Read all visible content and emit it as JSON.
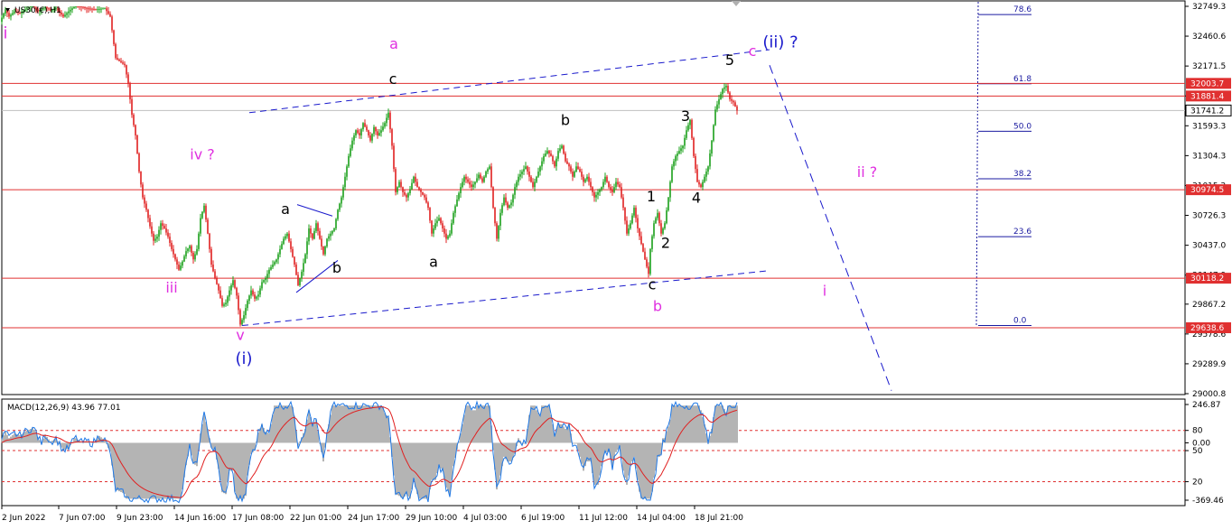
{
  "window": {
    "symbol_label": "US30(€),H1"
  },
  "chart_data": {
    "type": "candlestick",
    "ylim": [
      29000.8,
      32749.3
    ],
    "price_ticks": [
      "32749.3",
      "32460.6",
      "32171.5",
      "31882.4",
      "31593.3",
      "31304.3",
      "31015.2",
      "30726.3",
      "30437.0",
      "30147.9",
      "29867.2",
      "29578.6",
      "29289.9",
      "29000.8"
    ],
    "price_ticks_values": [
      32749.3,
      32460.6,
      32171.5,
      31882.4,
      31593.3,
      31304.3,
      31015.2,
      30726.3,
      30437.0,
      30147.9,
      29867.2,
      29578.6,
      29289.9,
      29000.8
    ],
    "x_tick_labels": [
      "2 Jun 2022",
      "7 Jun 07:00",
      "9 Jun 23:00",
      "14 Jun 16:00",
      "17 Jun 08:00",
      "22 Jun 01:00",
      "24 Jun 17:00",
      "29 Jun 10:00",
      "4 Jul 03:00",
      "6 Jul 19:00",
      "11 Jul 12:00",
      "14 Jul 04:00",
      "18 Jul 21:00"
    ],
    "levels": [
      {
        "label": "32003.7",
        "value": 32003.7,
        "color": "#e03030"
      },
      {
        "label": "31881.4",
        "value": 31881.4,
        "color": "#e03030"
      },
      {
        "label": "31741.2",
        "value": 31741.2,
        "color": "#ffffff"
      },
      {
        "label": "30974.5",
        "value": 30974.5,
        "color": "#e03030"
      },
      {
        "label": "30118.2",
        "value": 30118.2,
        "color": "#e03030"
      },
      {
        "label": "29638.6",
        "value": 29638.6,
        "color": "#e03030"
      }
    ],
    "fib_levels": [
      {
        "label": "78.6",
        "value": 32670
      },
      {
        "label": "61.8",
        "value": 32000
      },
      {
        "label": "50.0",
        "value": 31540
      },
      {
        "label": "38.2",
        "value": 31080
      },
      {
        "label": "23.6",
        "value": 30520
      },
      {
        "label": "0.0",
        "value": 29660
      }
    ],
    "close_path": [
      [
        0,
        32600
      ],
      [
        6,
        32720
      ],
      [
        10,
        32650
      ],
      [
        16,
        32700
      ],
      [
        22,
        32680
      ],
      [
        28,
        32720
      ],
      [
        36,
        32760
      ],
      [
        42,
        32700
      ],
      [
        50,
        32740
      ],
      [
        56,
        32710
      ],
      [
        62,
        32730
      ],
      [
        70,
        32650
      ],
      [
        76,
        32700
      ],
      [
        84,
        32760
      ],
      [
        96,
        32730
      ],
      [
        106,
        32720
      ],
      [
        116,
        32730
      ],
      [
        122,
        32650
      ],
      [
        128,
        32250
      ],
      [
        132,
        32220
      ],
      [
        138,
        32180
      ],
      [
        142,
        32000
      ],
      [
        146,
        31700
      ],
      [
        150,
        31500
      ],
      [
        154,
        31150
      ],
      [
        158,
        30900
      ],
      [
        162,
        30780
      ],
      [
        166,
        30620
      ],
      [
        170,
        30480
      ],
      [
        174,
        30520
      ],
      [
        178,
        30650
      ],
      [
        182,
        30600
      ],
      [
        186,
        30520
      ],
      [
        190,
        30400
      ],
      [
        194,
        30300
      ],
      [
        198,
        30200
      ],
      [
        202,
        30280
      ],
      [
        206,
        30380
      ],
      [
        210,
        30430
      ],
      [
        214,
        30300
      ],
      [
        218,
        30400
      ],
      [
        222,
        30700
      ],
      [
        226,
        30820
      ],
      [
        230,
        30550
      ],
      [
        234,
        30250
      ],
      [
        238,
        30120
      ],
      [
        242,
        30000
      ],
      [
        246,
        29850
      ],
      [
        250,
        29880
      ],
      [
        254,
        30000
      ],
      [
        258,
        30100
      ],
      [
        262,
        29950
      ],
      [
        266,
        29670
      ],
      [
        270,
        29760
      ],
      [
        274,
        29900
      ],
      [
        278,
        30000
      ],
      [
        282,
        29920
      ],
      [
        286,
        29960
      ],
      [
        290,
        30080
      ],
      [
        294,
        30120
      ],
      [
        298,
        30200
      ],
      [
        302,
        30250
      ],
      [
        306,
        30300
      ],
      [
        310,
        30400
      ],
      [
        314,
        30500
      ],
      [
        318,
        30550
      ],
      [
        322,
        30400
      ],
      [
        326,
        30250
      ],
      [
        330,
        30050
      ],
      [
        334,
        30180
      ],
      [
        338,
        30350
      ],
      [
        342,
        30600
      ],
      [
        346,
        30500
      ],
      [
        350,
        30650
      ],
      [
        354,
        30500
      ],
      [
        358,
        30350
      ],
      [
        362,
        30500
      ],
      [
        366,
        30550
      ],
      [
        370,
        30600
      ],
      [
        374,
        30780
      ],
      [
        378,
        30900
      ],
      [
        382,
        31100
      ],
      [
        386,
        31300
      ],
      [
        390,
        31450
      ],
      [
        394,
        31550
      ],
      [
        398,
        31500
      ],
      [
        402,
        31620
      ],
      [
        406,
        31550
      ],
      [
        410,
        31450
      ],
      [
        414,
        31580
      ],
      [
        418,
        31500
      ],
      [
        422,
        31550
      ],
      [
        426,
        31620
      ],
      [
        430,
        31720
      ],
      [
        434,
        31400
      ],
      [
        438,
        30950
      ],
      [
        442,
        31050
      ],
      [
        446,
        30950
      ],
      [
        450,
        30900
      ],
      [
        454,
        30980
      ],
      [
        458,
        31100
      ],
      [
        462,
        31000
      ],
      [
        466,
        30950
      ],
      [
        470,
        30900
      ],
      [
        474,
        30800
      ],
      [
        478,
        30550
      ],
      [
        482,
        30650
      ],
      [
        486,
        30700
      ],
      [
        490,
        30600
      ],
      [
        494,
        30500
      ],
      [
        498,
        30550
      ],
      [
        502,
        30750
      ],
      [
        506,
        30880
      ],
      [
        510,
        31000
      ],
      [
        514,
        31100
      ],
      [
        518,
        31050
      ],
      [
        522,
        31000
      ],
      [
        526,
        31050
      ],
      [
        530,
        31120
      ],
      [
        534,
        31050
      ],
      [
        538,
        31150
      ],
      [
        542,
        31200
      ],
      [
        546,
        30800
      ],
      [
        550,
        30500
      ],
      [
        554,
        30750
      ],
      [
        558,
        30900
      ],
      [
        562,
        30800
      ],
      [
        566,
        30850
      ],
      [
        570,
        31000
      ],
      [
        574,
        31100
      ],
      [
        578,
        31150
      ],
      [
        582,
        31200
      ],
      [
        586,
        31100
      ],
      [
        590,
        31000
      ],
      [
        594,
        31100
      ],
      [
        598,
        31200
      ],
      [
        602,
        31300
      ],
      [
        606,
        31350
      ],
      [
        610,
        31300
      ],
      [
        614,
        31200
      ],
      [
        618,
        31350
      ],
      [
        622,
        31400
      ],
      [
        626,
        31250
      ],
      [
        630,
        31200
      ],
      [
        634,
        31100
      ],
      [
        638,
        31200
      ],
      [
        642,
        31150
      ],
      [
        646,
        31050
      ],
      [
        650,
        31100
      ],
      [
        654,
        31000
      ],
      [
        658,
        30900
      ],
      [
        662,
        30950
      ],
      [
        666,
        31000
      ],
      [
        670,
        31100
      ],
      [
        674,
        31000
      ],
      [
        678,
        30950
      ],
      [
        682,
        31050
      ],
      [
        686,
        31000
      ],
      [
        690,
        30800
      ],
      [
        694,
        30550
      ],
      [
        698,
        30650
      ],
      [
        702,
        30800
      ],
      [
        706,
        30600
      ],
      [
        710,
        30450
      ],
      [
        714,
        30300
      ],
      [
        718,
        30160
      ],
      [
        720,
        30400
      ],
      [
        724,
        30650
      ],
      [
        728,
        30750
      ],
      [
        732,
        30550
      ],
      [
        736,
        30650
      ],
      [
        740,
        30900
      ],
      [
        744,
        31200
      ],
      [
        748,
        31300
      ],
      [
        752,
        31350
      ],
      [
        756,
        31400
      ],
      [
        760,
        31550
      ],
      [
        764,
        31650
      ],
      [
        768,
        31300
      ],
      [
        772,
        31050
      ],
      [
        776,
        31000
      ],
      [
        780,
        31100
      ],
      [
        784,
        31200
      ],
      [
        788,
        31450
      ],
      [
        792,
        31750
      ],
      [
        796,
        31850
      ],
      [
        800,
        31950
      ],
      [
        804,
        31980
      ],
      [
        808,
        31850
      ],
      [
        812,
        31820
      ],
      [
        816,
        31741
      ]
    ],
    "macd": {
      "label": "MACD(12,26,9) 43.96 77.01",
      "ticks": [
        "246.87",
        "80",
        "0.00",
        "50",
        "20",
        "-369.46"
      ],
      "ylim": [
        -369.46,
        246.87
      ],
      "tick_values": [
        246.87,
        80,
        0.0,
        -50,
        -250,
        -369.46
      ]
    },
    "annotations": [
      {
        "text": "i",
        "x": 6,
        "price": 32440,
        "color": "#e030e0",
        "size": 18
      },
      {
        "text": "iv ?",
        "x": 224,
        "price": 31270,
        "color": "#e030e0",
        "size": 16
      },
      {
        "text": "iii",
        "x": 190,
        "price": 29980,
        "color": "#e030e0",
        "size": 16
      },
      {
        "text": "v",
        "x": 266,
        "price": 29520,
        "color": "#e030e0",
        "size": 16
      },
      {
        "text": "(i)",
        "x": 270,
        "price": 29290,
        "color": "#1a1acc",
        "size": 18
      },
      {
        "text": "a",
        "x": 316,
        "price": 30740,
        "color": "#000000",
        "size": 16
      },
      {
        "text": "b",
        "x": 373,
        "price": 30170,
        "color": "#000000",
        "size": 16
      },
      {
        "text": "a",
        "x": 436,
        "price": 32340,
        "color": "#e030e0",
        "size": 16
      },
      {
        "text": "c",
        "x": 435,
        "price": 32000,
        "color": "#000000",
        "size": 16
      },
      {
        "text": "a",
        "x": 480,
        "price": 30230,
        "color": "#000000",
        "size": 16
      },
      {
        "text": "b",
        "x": 626,
        "price": 31600,
        "color": "#000000",
        "size": 16
      },
      {
        "text": "c",
        "x": 722,
        "price": 30010,
        "color": "#000000",
        "size": 16
      },
      {
        "text": "b",
        "x": 728,
        "price": 29800,
        "color": "#e030e0",
        "size": 16
      },
      {
        "text": "1",
        "x": 721,
        "price": 30860,
        "color": "#000000",
        "size": 16
      },
      {
        "text": "2",
        "x": 737,
        "price": 30410,
        "color": "#000000",
        "size": 16
      },
      {
        "text": "3",
        "x": 759,
        "price": 31640,
        "color": "#000000",
        "size": 16
      },
      {
        "text": "4",
        "x": 771,
        "price": 30850,
        "color": "#000000",
        "size": 16
      },
      {
        "text": "5",
        "x": 808,
        "price": 32180,
        "color": "#000000",
        "size": 16
      },
      {
        "text": "c",
        "x": 833,
        "price": 32270,
        "color": "#e030e0",
        "size": 16
      },
      {
        "text": "(ii) ?",
        "x": 864,
        "price": 32350,
        "color": "#1a1acc",
        "size": 18
      },
      {
        "text": "ii ?",
        "x": 960,
        "price": 31100,
        "color": "#e030e0",
        "size": 16
      },
      {
        "text": "i",
        "x": 913,
        "price": 29950,
        "color": "#e030e0",
        "size": 16
      }
    ],
    "trendlines": [
      {
        "x1": 276,
        "p1": 31720,
        "x2": 852,
        "p2": 32330,
        "dash": "7,5"
      },
      {
        "x1": 268,
        "p1": 29660,
        "x2": 850,
        "p2": 30190,
        "dash": "7,5"
      },
      {
        "x1": 852,
        "p1": 32180,
        "x2": 987,
        "p2": 29030,
        "dash": "10,6"
      }
    ],
    "ticklines": [
      {
        "x1": 329,
        "p1": 30830,
        "x2": 368,
        "p2": 30720
      },
      {
        "x1": 328,
        "p1": 29980,
        "x2": 374,
        "p2": 30290
      }
    ]
  }
}
